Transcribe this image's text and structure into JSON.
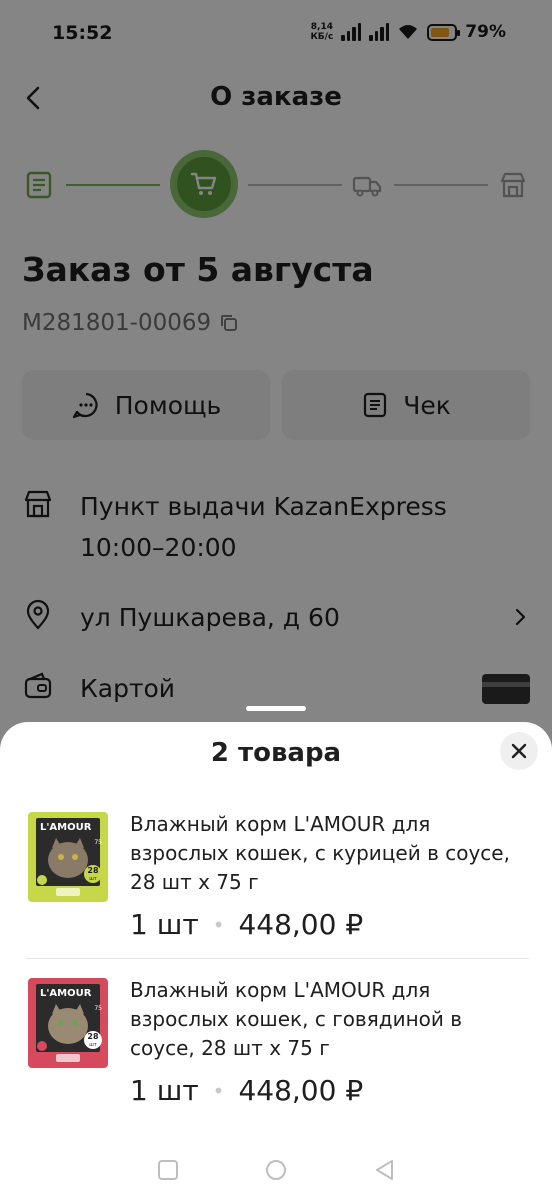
{
  "status_bar": {
    "time": "15:52",
    "net_speed_value": "8,14",
    "net_speed_unit": "КБ/с",
    "battery_percent": "79%",
    "battery_level": 0.79,
    "battery_color": "#f5a623"
  },
  "header": {
    "title": "О заказе",
    "back_icon": "chevron-left-icon"
  },
  "stepper": {
    "steps": [
      "document-icon",
      "cart-icon",
      "truck-icon",
      "store-icon"
    ],
    "active_step": 1,
    "accent_color": "#5a9e3c"
  },
  "order": {
    "title": "Заказ от 5 августа",
    "number": "M281801-00069"
  },
  "buttons": {
    "help_label": "Помощь",
    "receipt_label": "Чек"
  },
  "info": {
    "pickup_line1": "Пункт выдачи KazanExpress",
    "pickup_line2": "10:00–20:00",
    "address": "ул Пушкарева, д 60",
    "payment": "Картой"
  },
  "sheet": {
    "title": "2 товара",
    "items": [
      {
        "name": "Влажный корм L'AMOUR для взрослых кошек, с курицей в соусе, 28 шт х 75 г",
        "qty": "1 шт",
        "price": "448,00 ₽",
        "package_brand": "L'AMOUR",
        "package_badge": "28",
        "package_badge_unit": "шт",
        "package_weight": "75",
        "package_color": "#c6d84a"
      },
      {
        "name": "Влажный корм L'AMOUR для взрослых кошек, с говядиной в соусе, 28 шт х 75 г",
        "qty": "1 шт",
        "price": "448,00 ₽",
        "package_brand": "L'AMOUR",
        "package_badge": "28",
        "package_badge_unit": "шт",
        "package_weight": "75",
        "package_color": "#d64a5e"
      }
    ]
  }
}
